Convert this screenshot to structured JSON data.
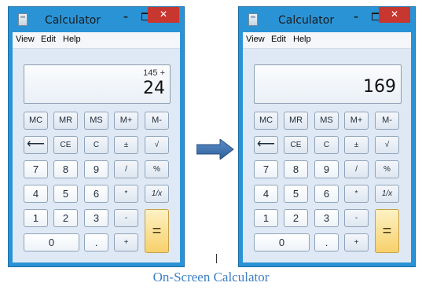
{
  "left_window": {
    "title": "Calculator",
    "menu": [
      "View",
      "Edit",
      "Help"
    ],
    "display": {
      "expression": "145 +",
      "value": "24"
    }
  },
  "right_window": {
    "title": "Calculator",
    "menu": [
      "View",
      "Edit",
      "Help"
    ],
    "display": {
      "expression": "",
      "value": "169"
    }
  },
  "keypad": {
    "memory": [
      "MC",
      "MR",
      "MS",
      "M+",
      "M-"
    ],
    "row2": [
      "⟵",
      "CE",
      "C",
      "±",
      "√"
    ],
    "row3": [
      "7",
      "8",
      "9",
      "/",
      "%"
    ],
    "row4": [
      "4",
      "5",
      "6",
      "*",
      "1/x"
    ],
    "row5": [
      "1",
      "2",
      "3",
      "-"
    ],
    "row6": [
      "0",
      ".",
      "+"
    ],
    "equals": "="
  },
  "titlebar": {
    "minimize": "–",
    "close": "✕"
  },
  "icons": {
    "arrow": "right-arrow-icon"
  },
  "colors": {
    "frame": "#2a93d6",
    "close": "#c7372f",
    "equals": "#f7d06b",
    "caption": "#3b7fc4"
  },
  "caption": "On-Screen Calculator"
}
